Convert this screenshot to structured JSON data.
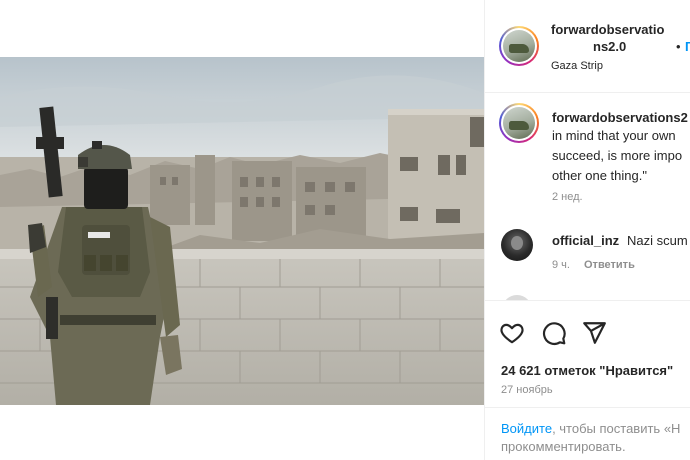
{
  "post": {
    "author": {
      "username_line1": "forwardobservatio",
      "username_line2": "ns2.0",
      "separator": "•",
      "follow_label": "П",
      "location": "Gaza Strip"
    },
    "caption": {
      "username": "forwardobservations2",
      "lines": [
        "in mind that your own",
        "succeed, is more impo",
        "other one thing.\""
      ],
      "time": "2 нед."
    },
    "comments": [
      {
        "username": "official_inz",
        "text": "Nazi scum",
        "time": "9 ч.",
        "reply_label": "Ответить"
      }
    ],
    "actions": {
      "like_icon": "heart-icon",
      "comment_icon": "comment-icon",
      "share_icon": "paper-plane-icon"
    },
    "likes_text": "24 621 отметок \"Нравится\"",
    "date": "27 ноябрь",
    "login_prompt": {
      "link": "Войдите",
      "rest_line1": ", чтобы поставить «Н",
      "line2": "прокомментировать."
    }
  },
  "colors": {
    "link": "#0095f6",
    "secondary_text": "#8e8e8e",
    "primary_text": "#262626",
    "divider": "#efefef"
  }
}
